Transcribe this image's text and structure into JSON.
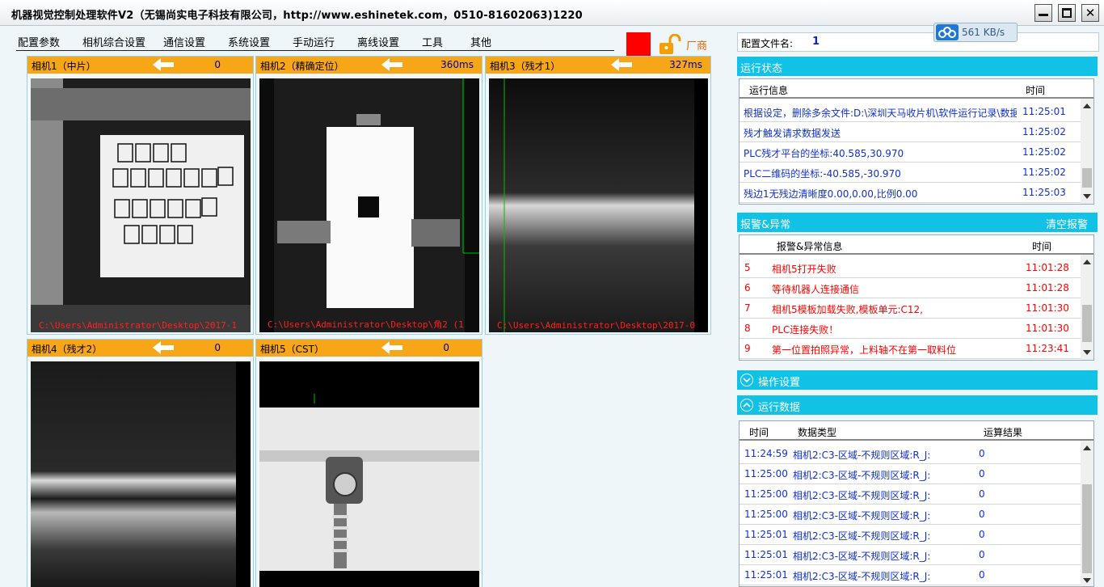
{
  "window": {
    "title": "机器视觉控制处理软件V2（无锡尚实电子科技有限公司，http://www.eshinetek.com，0510-81602063)1220"
  },
  "menu": [
    "配置参数",
    "相机综合设置",
    "通信设置",
    "系统设置",
    "手动运行",
    "离线设置",
    "工具",
    "其他"
  ],
  "vendor_label": "厂商",
  "cameras": [
    {
      "name": "相机1（中片）",
      "value": "0",
      "path": "C:\\Users\\Administrator\\Desktop\\2017-1"
    },
    {
      "name": "相机2（精确定位）",
      "value": "360ms",
      "path": "C:\\Users\\Administrator\\Desktop\\角2 (1"
    },
    {
      "name": "相机3（残才1）",
      "value": "327ms",
      "path": "C:\\Users\\Administrator\\Desktop\\2017-0"
    },
    {
      "name": "相机4（残才2）",
      "value": "0",
      "path": ""
    },
    {
      "name": "相机5（CST）",
      "value": "0",
      "path": ""
    }
  ],
  "config": {
    "label": "配置文件名:",
    "value": "1"
  },
  "network": {
    "speed": "561 KB/s"
  },
  "run_status": {
    "title": "运行状态",
    "headers": {
      "info": "运行信息",
      "time": "时间"
    },
    "rows": [
      {
        "info": "根据设定，删除多余文件:D:\\深圳天马收片机\\软件运行记录\\数据",
        "time": "11:25:01"
      },
      {
        "info": "残才触发请求数据发送",
        "time": "11:25:02"
      },
      {
        "info": "PLC残才平台的坐标:40.585,30.970",
        "time": "11:25:02"
      },
      {
        "info": "PLC二维码的坐标:-40.585,-30.970",
        "time": "11:25:02"
      },
      {
        "info": "残边1无残边清晰度0.00,0.00,比例0.00",
        "time": "11:25:03"
      }
    ]
  },
  "alarms": {
    "title": "报警&异常",
    "clear": "清空报警",
    "headers": {
      "info": "报警&异常信息",
      "time": "时间"
    },
    "rows": [
      {
        "no": "5",
        "info": "相机5打开失败",
        "time": "11:01:28"
      },
      {
        "no": "6",
        "info": "等待机器人连接通信",
        "time": "11:01:28"
      },
      {
        "no": "7",
        "info": "相机5模板加载失败,模板单元:C12,",
        "time": "11:01:30"
      },
      {
        "no": "8",
        "info": "PLC连接失败！",
        "time": "11:01:30"
      },
      {
        "no": "9",
        "info": "第一位置拍照异常，上料轴不在第一取料位",
        "time": "11:23:41"
      }
    ]
  },
  "ops": {
    "title": "操作设置"
  },
  "run_data": {
    "title": "运行数据",
    "headers": {
      "time": "时间",
      "type": "数据类型",
      "result": "运算结果"
    },
    "rows": [
      {
        "time": "11:24:59",
        "type": "相机2:C3-区域-不规则区域:R_J:",
        "result": "0"
      },
      {
        "time": "11:25:00",
        "type": "相机2:C3-区域-不规则区域:R_J:",
        "result": "0"
      },
      {
        "time": "11:25:00",
        "type": "相机2:C3-区域-不规则区域:R_J:",
        "result": "0"
      },
      {
        "time": "11:25:00",
        "type": "相机2:C3-区域-不规则区域:R_J:",
        "result": "0"
      },
      {
        "time": "11:25:01",
        "type": "相机2:C3-区域-不规则区域:R_J:",
        "result": "0"
      },
      {
        "time": "11:25:01",
        "type": "相机2:C3-区域-不规则区域:R_J:",
        "result": "0"
      },
      {
        "time": "11:25:01",
        "type": "相机2:C3-区域-不规则区域:R_J:",
        "result": "0"
      }
    ]
  },
  "colors": {
    "accent": "#11c1e6",
    "camera_header": "#f7a617",
    "alarm_text": "#ff0000",
    "info_text": "#1030d0"
  }
}
